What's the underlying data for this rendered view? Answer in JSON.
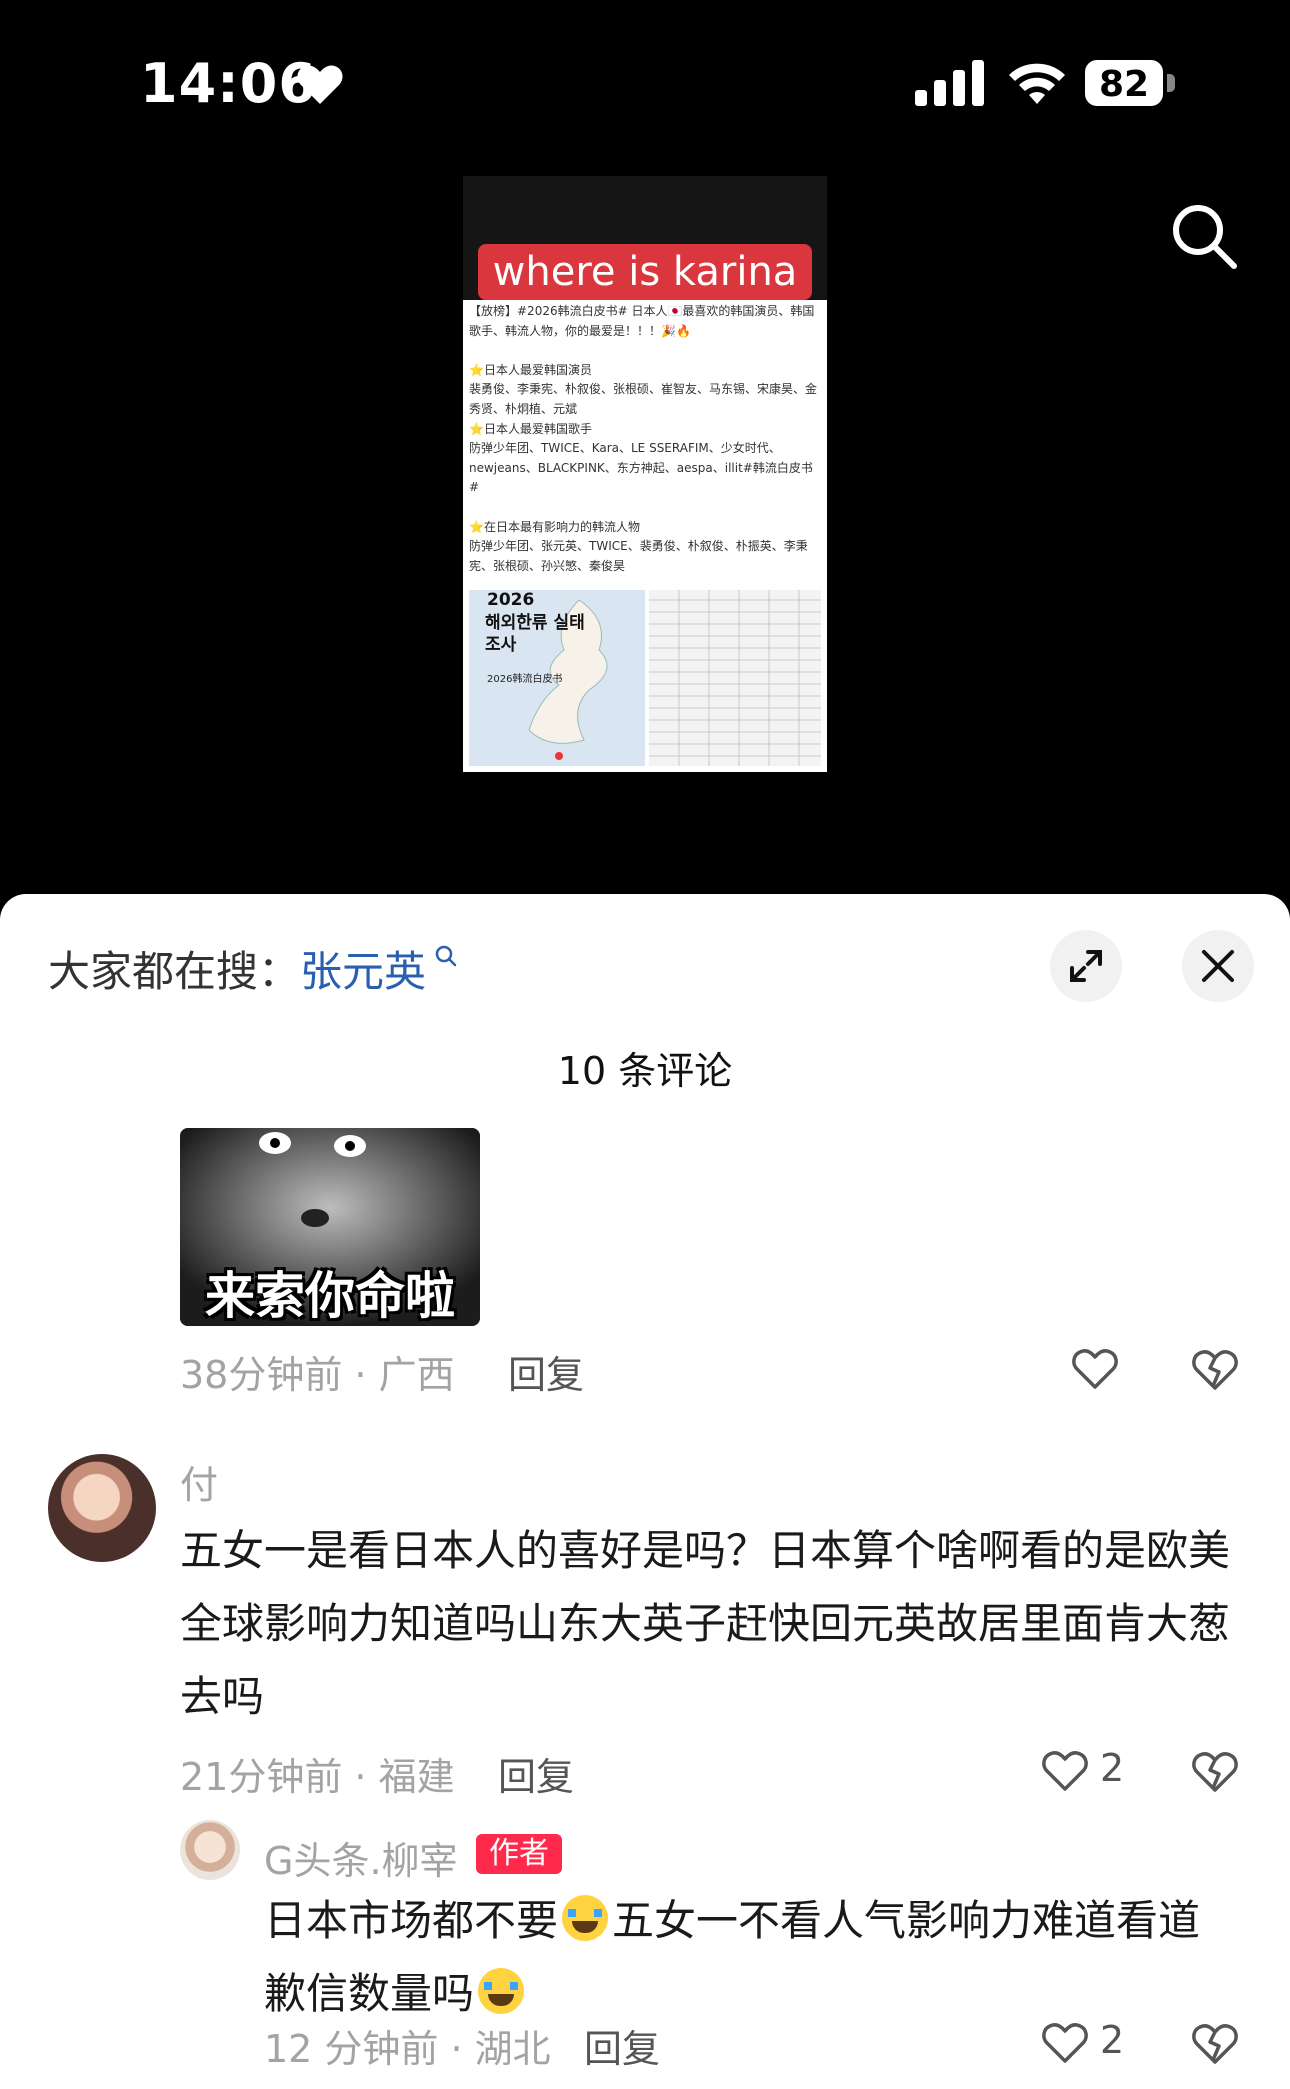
{
  "status_bar": {
    "time": "14:06",
    "battery": "82"
  },
  "video": {
    "title": "where is karina",
    "post_text": "【放榜】#2026韩流白皮书# 日本人🇯🇵最喜欢的韩国演员、韩国歌手、韩流人物，你的最爱是！！！🎉🔥\n\n⭐日本人最爱韩国演员\n裴勇俊、李秉宪、朴叙俊、张根硕、崔智友、马东锡、宋康昊、金秀贤、朴炯植、元斌\n⭐日本人最爱韩国歌手\n防弹少年团、TWICE、Kara、LE SSERAFIM、少女时代、newjeans、BLACKPINK、东方神起、aespa、illit#韩流白皮书#\n\n⭐在日本最有影响力的韩流人物\n防弹少年团、张元英、TWICE、裴勇俊、朴叙俊、朴振英、李秉宪、张根硕、孙兴慜、秦俊昊",
    "map_year": "2026",
    "map_title": "해외한류 실태조사",
    "map_subtitle": "2026韩流白皮书"
  },
  "sheet": {
    "hot_search_prefix": "大家都在搜：",
    "hot_search_keyword": "张元英",
    "comment_count": "10 条评论",
    "comments": [
      {
        "sticker_text": "来索你命啦",
        "meta": "38分钟前 · 广西",
        "reply": "回复"
      },
      {
        "user": "付",
        "text": "五女一是看日本人的喜好是吗？日本算个啥啊看的是欧美全球影响力知道吗山东大英子赶快回元英故居里面肯大葱去吗",
        "meta": "21分钟前 · 福建",
        "reply": "回复",
        "likes": "2"
      },
      {
        "user": "G头条.柳宰",
        "badge": "作者",
        "text_part1": "日本市场都不要",
        "text_part2": "五女一不看人气影响力难道看道歉信数量吗",
        "meta": "12 分钟前 · 湖北",
        "reply": "回复",
        "likes": "2"
      }
    ]
  }
}
